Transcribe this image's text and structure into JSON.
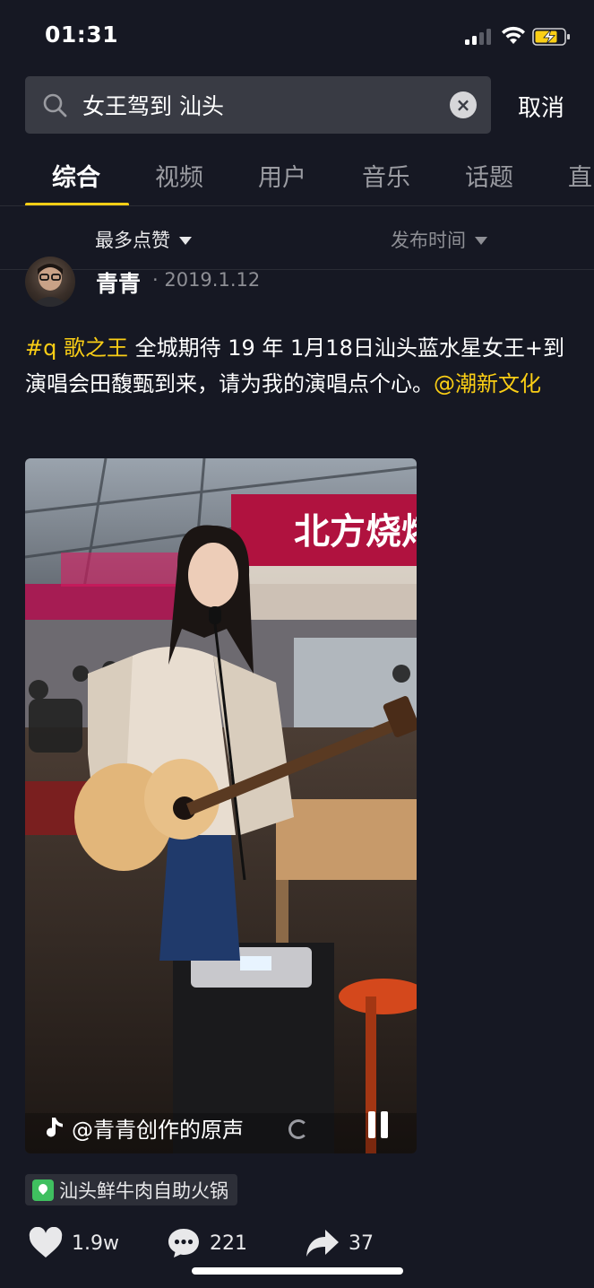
{
  "status_bar": {
    "time": "01:31",
    "icons": [
      "signal-icon",
      "wifi-icon",
      "battery-charging-icon"
    ]
  },
  "search": {
    "query": "女王驾到 汕头",
    "cancel_label": "取消",
    "icons": [
      "search-icon",
      "clear-icon"
    ]
  },
  "tabs": [
    {
      "label": "综合",
      "active": true
    },
    {
      "label": "视频",
      "active": false
    },
    {
      "label": "用户",
      "active": false
    },
    {
      "label": "音乐",
      "active": false
    },
    {
      "label": "话题",
      "active": false
    },
    {
      "label": "直",
      "active": false
    }
  ],
  "filters": {
    "sort_label": "最多点赞",
    "time_label": "发布时间"
  },
  "post": {
    "author": "青青",
    "date": "· 2019.1.12",
    "caption": {
      "hashtag": "#q 歌之王",
      "body": " 全城期待 19 年 1月18日汕头蓝水星女王+到演唱会田馥甄到来，请为我的演唱点个心。",
      "mention": "@潮新文化"
    },
    "video": {
      "music_label": "@青青创作的原声",
      "sign_text": "北方烧烤"
    },
    "location": "汕头鲜牛肉自助火锅",
    "stats": {
      "likes": "1.9w",
      "comments": "221",
      "shares": "37"
    }
  },
  "colors": {
    "background": "#161823",
    "accent": "#face15",
    "secondary_text": "#8e8f95",
    "location_green": "#3fbf5f"
  }
}
